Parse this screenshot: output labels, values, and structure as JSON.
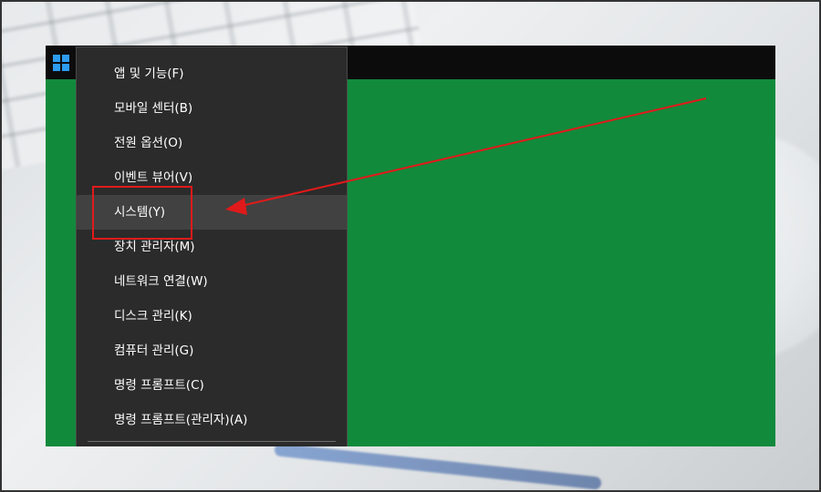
{
  "menu": {
    "items": [
      {
        "label": "앱 및 기능(F)"
      },
      {
        "label": "모바일 센터(B)"
      },
      {
        "label": "전원 옵션(O)"
      },
      {
        "label": "이벤트 뷰어(V)"
      },
      {
        "label": "시스템(Y)",
        "highlighted": true
      },
      {
        "label": "장치 관리자(M)"
      },
      {
        "label": "네트워크 연결(W)"
      },
      {
        "label": "디스크 관리(K)"
      },
      {
        "label": "컴퓨터 관리(G)"
      },
      {
        "label": "명령 프롬프트(C)"
      },
      {
        "label": "명령 프롬프트(관리자)(A)"
      }
    ]
  },
  "taskbar": {
    "start_icon": "windows-logo-icon"
  },
  "colors": {
    "desktop": "#128a3c",
    "taskbar": "#0c0c0c",
    "menu_bg": "#2b2b2b",
    "menu_hover": "#414141",
    "accent": "#2d9cf0",
    "annotation": "#e01a1a"
  }
}
